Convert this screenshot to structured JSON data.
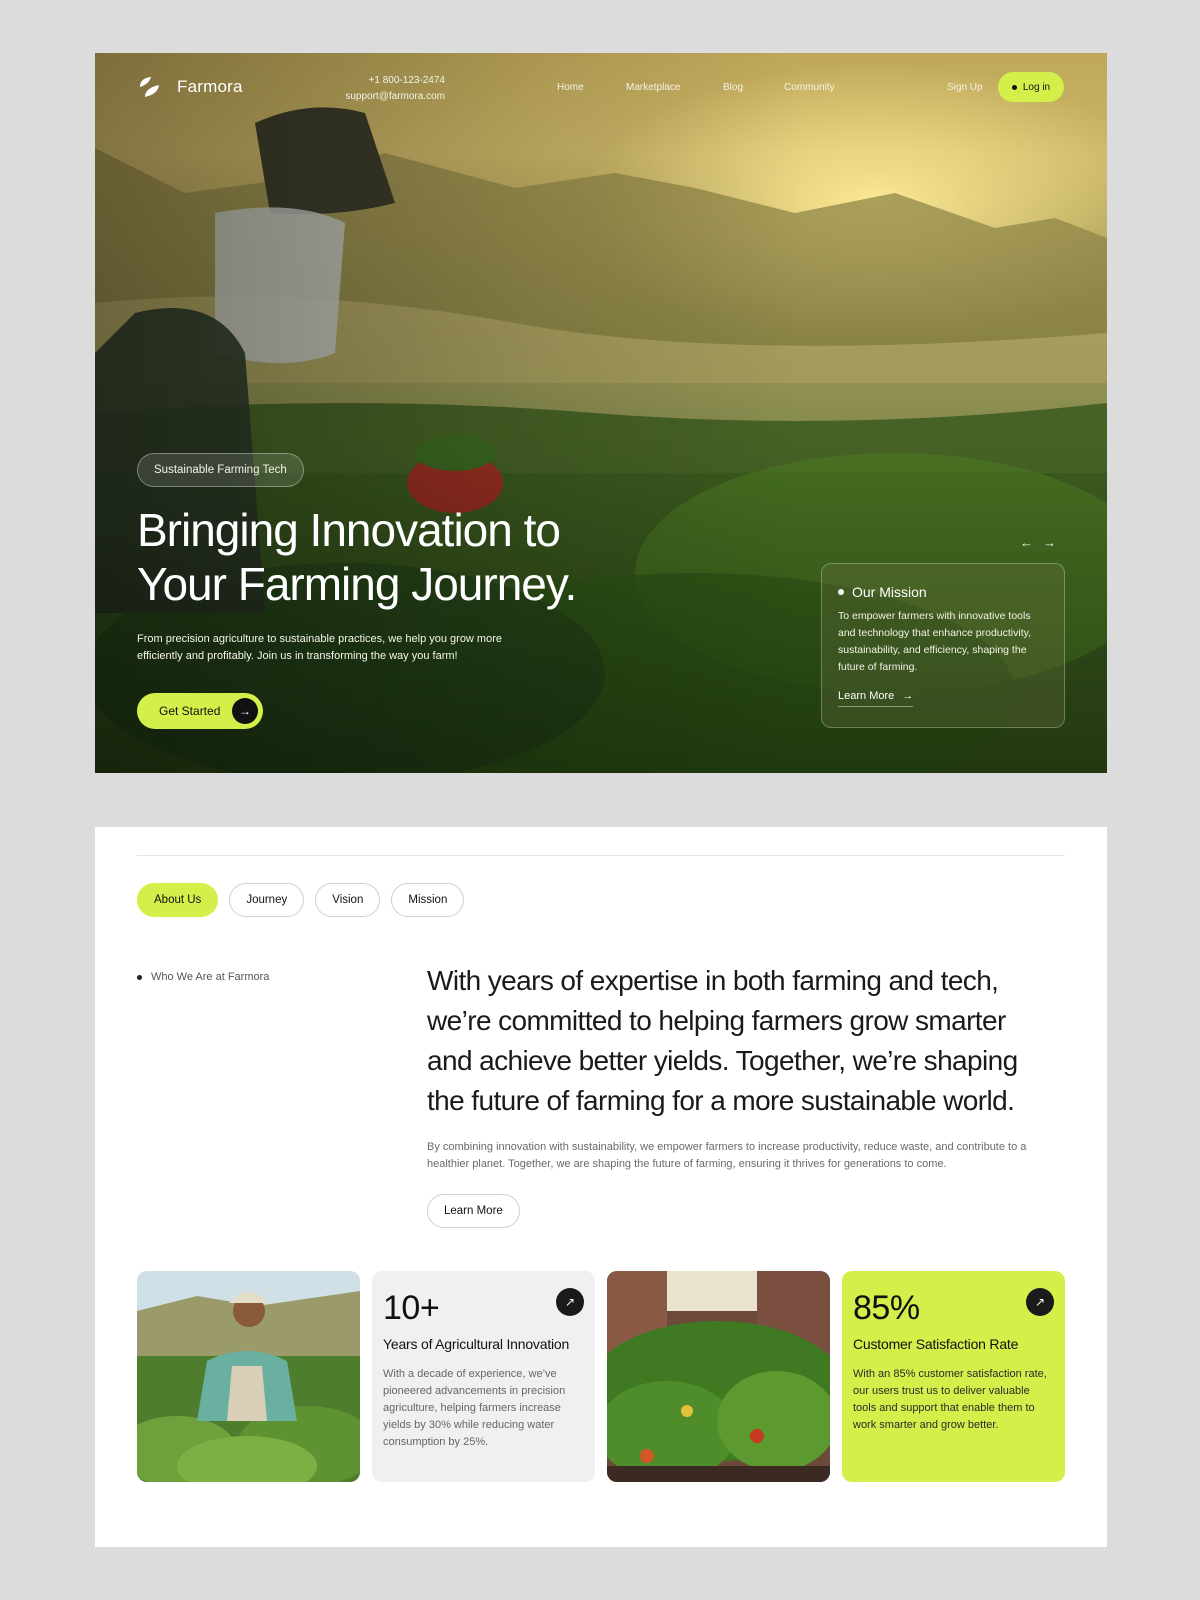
{
  "brand": {
    "name": "Farmora"
  },
  "contact": {
    "phone": "+1 800-123-2474",
    "email": "support@farmora.com"
  },
  "nav": {
    "home": "Home",
    "marketplace": "Marketplace",
    "blog": "Blog",
    "community": "Community",
    "signup": "Sign Up",
    "login": "Log in"
  },
  "hero": {
    "tag": "Sustainable Farming Tech",
    "title_line1": "Bringing Innovation to",
    "title_line2": "Your Farming Journey.",
    "description": "From precision agriculture to sustainable practices, we help you grow more efficiently and profitably. Join us in transforming the way you farm!",
    "cta": "Get Started",
    "prev_arrow": "←",
    "next_arrow": "→"
  },
  "mission": {
    "title": "Our Mission",
    "text": "To empower farmers with innovative tools and technology that enhance productivity, sustainability, and efficiency, shaping the future of farming.",
    "link": "Learn More"
  },
  "tabs": [
    "About Us",
    "Journey",
    "Vision",
    "Mission"
  ],
  "about": {
    "label": "Who We Are at Farmora",
    "lead": "With years of expertise in both farming and tech, we’re committed to helping farmers grow smarter and achieve better yields. Together, we’re shaping the future of farming for a more sustainable world.",
    "body": "By combining innovation with sustainability, we empower farmers to increase productivity, reduce waste, and contribute to a healthier planet. Together, we are shaping the future of farming, ensuring it thrives for generations to come.",
    "button": "Learn More"
  },
  "stats": [
    {
      "value": "10+",
      "title": "Years of Agricultural Innovation",
      "body": "With a decade of experience, we’ve pioneered advancements in precision agriculture, helping farmers increase yields by 30% while reducing water consumption by 25%."
    },
    {
      "value": "85%",
      "title": "Customer Satisfaction Rate",
      "body": "With an 85% customer satisfaction rate, our users trust us to deliver valuable tools and support that enable them to work smarter and grow better."
    }
  ],
  "colors": {
    "accent": "#d3f04a",
    "dark": "#111111"
  },
  "icons": {
    "arrow_right": "→",
    "arrow_up_right": "↗"
  }
}
